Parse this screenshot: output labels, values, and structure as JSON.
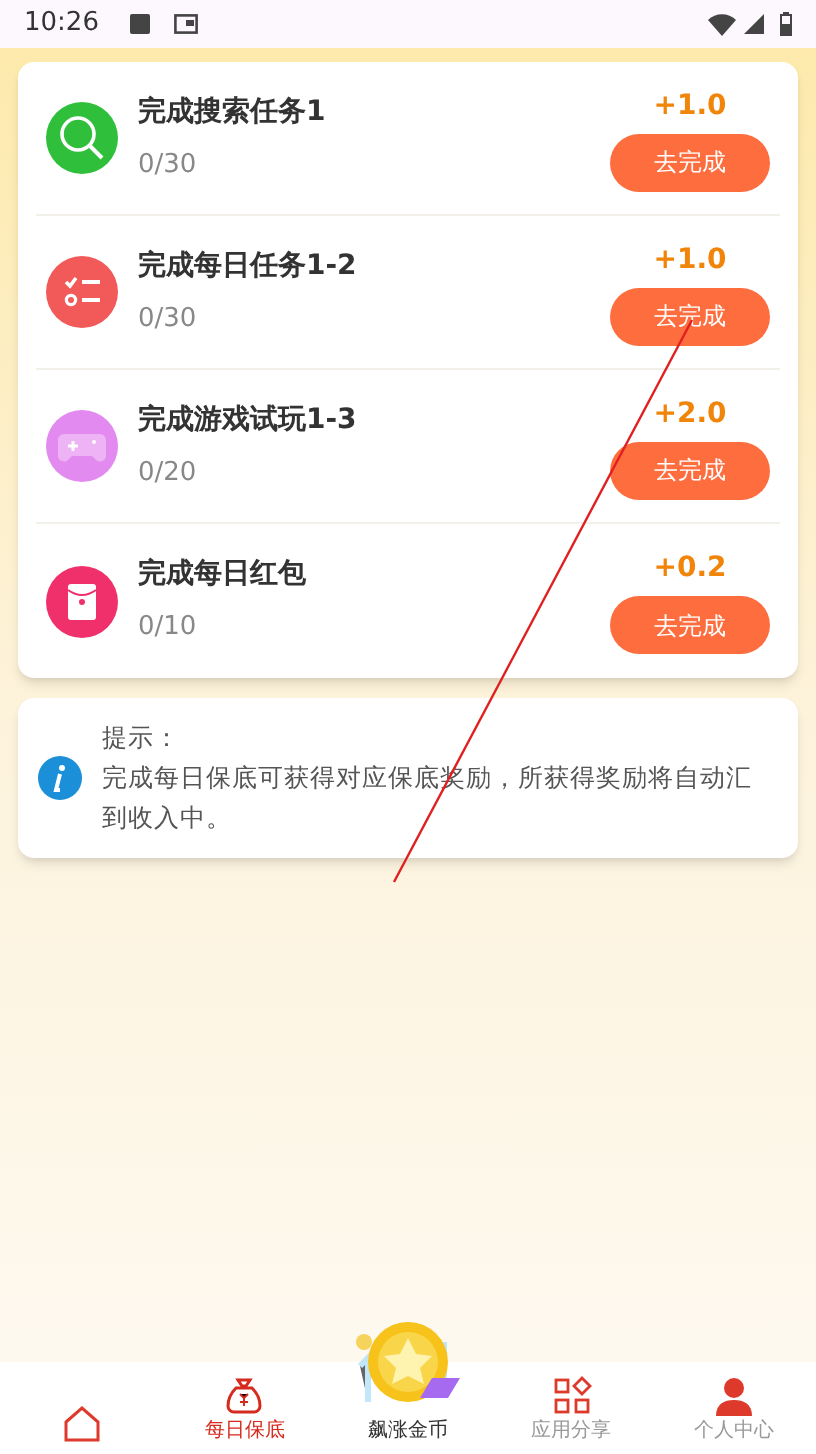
{
  "status_bar": {
    "time": "10:26"
  },
  "tasks": [
    {
      "kind": "search",
      "title": "完成搜索任务1",
      "progress": "0/30",
      "reward": "+1.0",
      "button": "去完成"
    },
    {
      "kind": "checklist",
      "title": "完成每日任务1-2",
      "progress": "0/30",
      "reward": "+1.0",
      "button": "去完成"
    },
    {
      "kind": "game",
      "title": "完成游戏试玩1-3",
      "progress": "0/20",
      "reward": "+2.0",
      "button": "去完成"
    },
    {
      "kind": "redpacket",
      "title": "完成每日红包",
      "progress": "0/10",
      "reward": "+0.2",
      "button": "去完成"
    }
  ],
  "tip": {
    "title": "提示：",
    "text": "完成每日保底可获得对应保底奖励，所获得奖励将自动汇到收入中。"
  },
  "bottom_nav": [
    {
      "kind": "home",
      "selected": false
    },
    {
      "kind": "moneybag",
      "label": "每日保底",
      "selected": true
    },
    {
      "kind": "coin",
      "label": "飙涨金币",
      "selected": false
    },
    {
      "kind": "apps",
      "label": "应用分享",
      "selected": false
    },
    {
      "kind": "person",
      "label": "个人中心",
      "selected": false
    }
  ]
}
